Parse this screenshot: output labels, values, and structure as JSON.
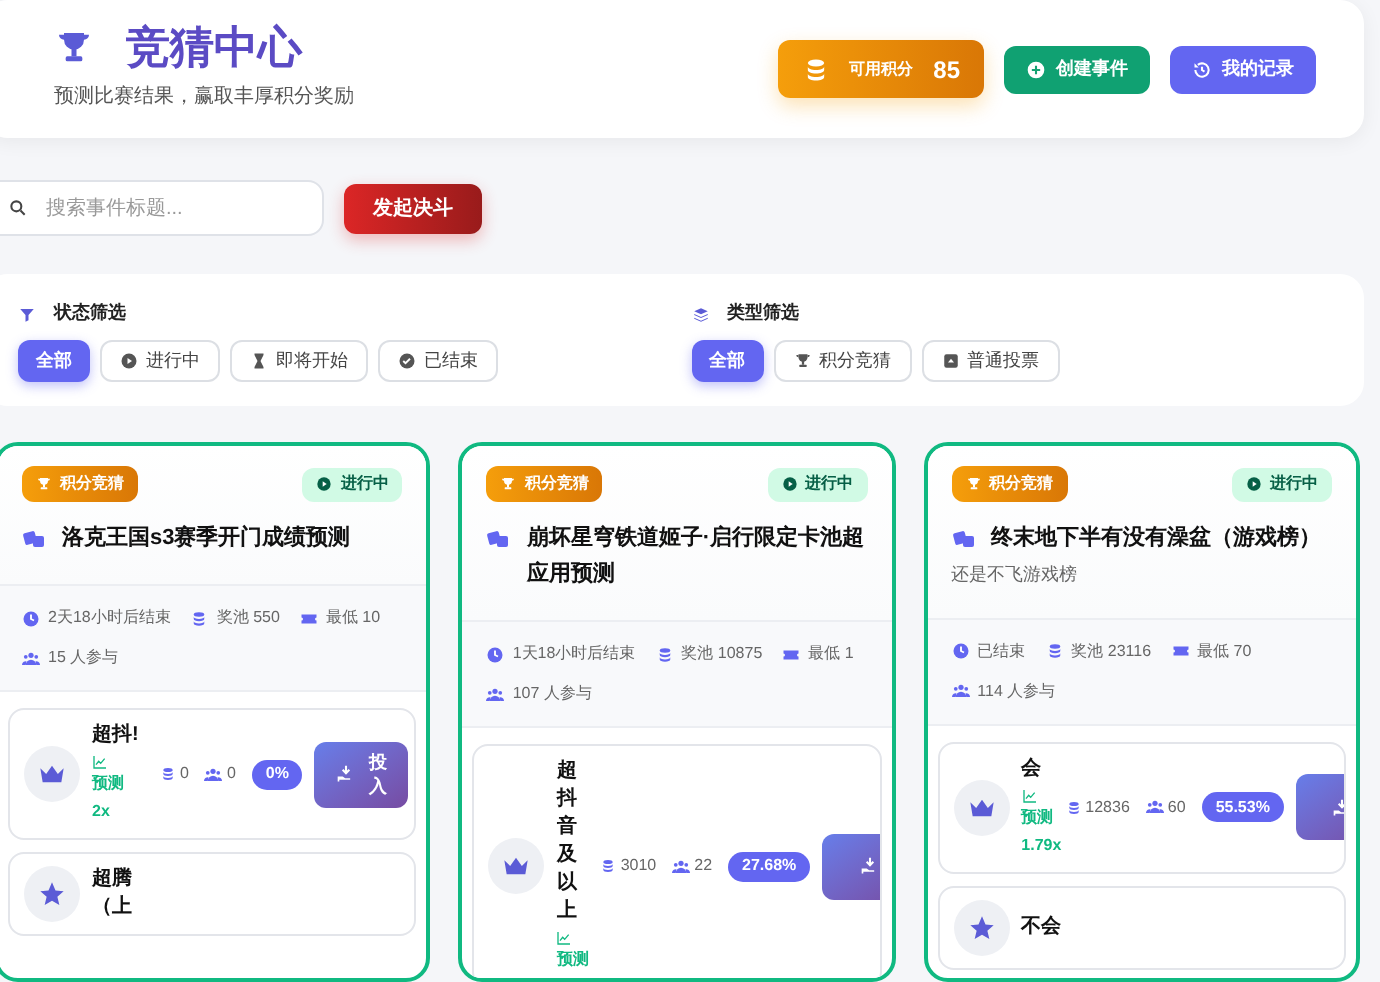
{
  "header": {
    "title": "竞猜中心",
    "subtitle": "预测比赛结果，赢取丰厚积分奖励",
    "points": {
      "label": "可用积分",
      "value": "85"
    },
    "buttons": [
      {
        "label": "创建事件",
        "kind": "create"
      },
      {
        "label": "我的记录",
        "kind": "history"
      }
    ]
  },
  "search": {
    "placeholder": "搜索事件标题...",
    "button": "发起决斗"
  },
  "filters": [
    {
      "title": "状态筛选",
      "kind": "status",
      "options": [
        {
          "label": "全部",
          "selected": true,
          "kind": "all"
        },
        {
          "label": "进行中",
          "selected": false,
          "kind": "running"
        },
        {
          "label": "即将开始",
          "selected": false,
          "kind": "upcoming"
        },
        {
          "label": "已结束",
          "selected": false,
          "kind": "ended"
        }
      ]
    },
    {
      "title": "类型筛选",
      "kind": "type",
      "options": [
        {
          "label": "全部",
          "selected": true,
          "kind": "all"
        },
        {
          "label": "积分竞猜",
          "selected": false,
          "kind": "points"
        },
        {
          "label": "普通投票",
          "selected": false,
          "kind": "vote"
        }
      ]
    }
  ],
  "events": [
    {
      "type_badge": "积分竞猜",
      "status_badge": "进行中",
      "title": "洛克王国s3赛季开门成绩预测",
      "meta": {
        "time": "2天18小时后结束",
        "pool": "奖池 550",
        "min": "最低 10",
        "participants": "15 人参与"
      },
      "options": [
        {
          "name": "超抖!",
          "prediction": "预测",
          "multiplier": "2x",
          "pool": "0",
          "people": "0",
          "percent": "0%",
          "button": "投入"
        },
        {
          "name": "超腾（上"
        }
      ]
    },
    {
      "type_badge": "积分竞猜",
      "status_badge": "进行中",
      "title": "崩坏星穹铁道姬子·启行限定卡池超应用预测",
      "meta": {
        "time": "1天18小时后结束",
        "pool": "奖池 10875",
        "min": "最低 1",
        "participants": "107 人参与"
      },
      "options": [
        {
          "name": "超抖音及以上",
          "prediction": "预测",
          "pool": "3010",
          "people": "22",
          "percent": "27.68%"
        }
      ]
    },
    {
      "type_badge": "积分竞猜",
      "status_badge": "进行中",
      "title": "终末地下半有没有澡盆（游戏榜）",
      "subtitle": "还是不飞游戏榜",
      "meta": {
        "time": "已结束",
        "pool": "奖池 23116",
        "min": "最低 70",
        "participants": "114 人参与"
      },
      "options": [
        {
          "name": "会",
          "prediction": "预测",
          "multiplier": "1.79x",
          "pool": "12836",
          "people": "60",
          "percent": "55.53%"
        },
        {
          "name": "不会"
        }
      ]
    }
  ]
}
